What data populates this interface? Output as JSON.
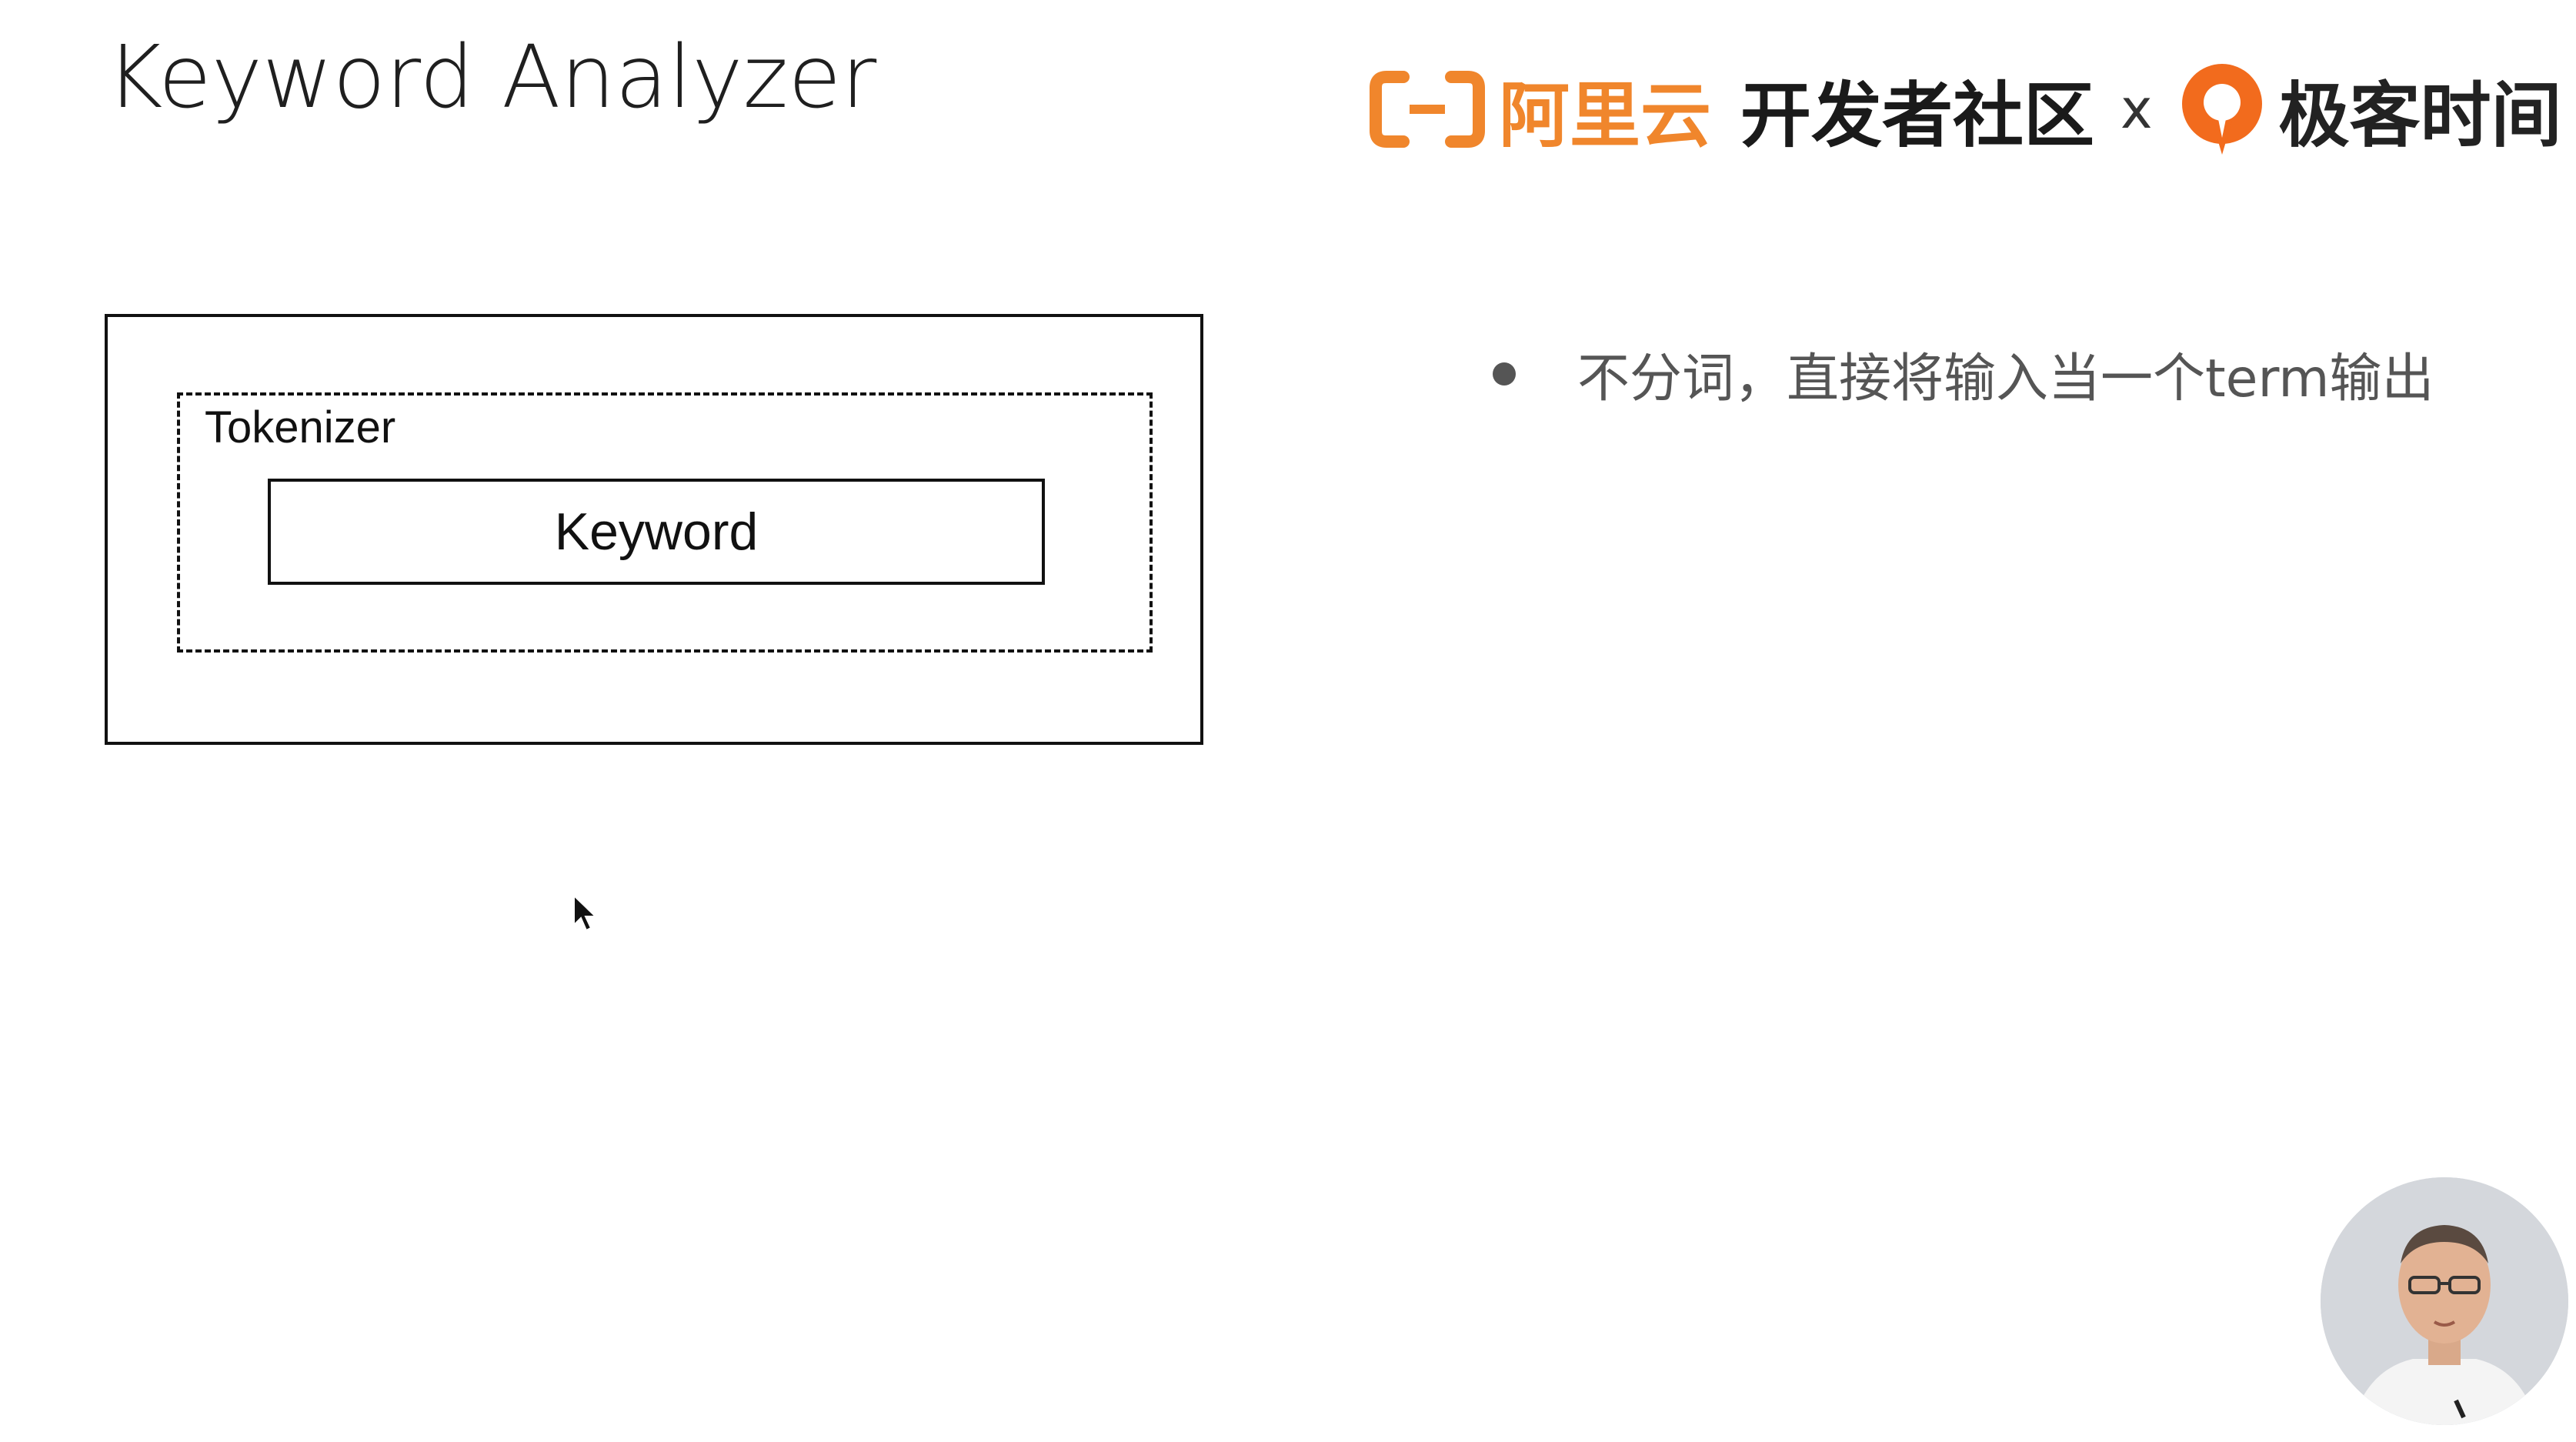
{
  "slide": {
    "title": "Keyword Analyzer"
  },
  "header": {
    "brand_primary": "阿里云",
    "brand_community": "开发者社区",
    "separator": "x",
    "brand_partner": "极客时间",
    "aliyun_color": "#f0862c",
    "geek_color": "#f26b1d"
  },
  "diagram": {
    "tokenizer_label": "Tokenizer",
    "keyword_label": "Keyword"
  },
  "bullets": [
    {
      "text": "不分词，直接将输入当一个term输出"
    }
  ],
  "icons": {
    "cursor": "mouse-pointer-icon",
    "aliyun_logo": "aliyun-bracket-logo-icon",
    "geek_logo": "geektime-logo-icon"
  }
}
